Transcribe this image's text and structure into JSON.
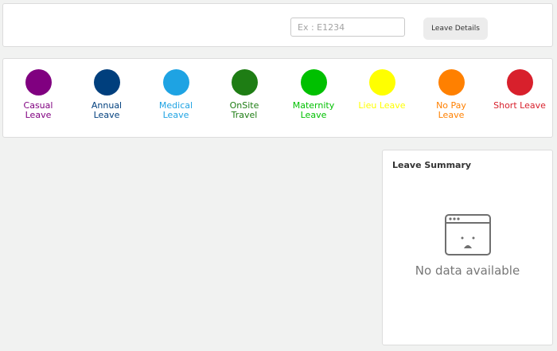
{
  "search": {
    "placeholder": "Ex : E1234",
    "value": ""
  },
  "toolbar": {
    "leave_details_label": "Leave Details"
  },
  "legend": [
    {
      "name": "casual",
      "line1": "Casual",
      "line2": "Leave",
      "color": "#800080"
    },
    {
      "name": "annual",
      "line1": "Annual",
      "line2": "Leave",
      "color": "#003f7d"
    },
    {
      "name": "medical",
      "line1": "Medical",
      "line2": "Leave",
      "color": "#1ea3e3"
    },
    {
      "name": "onsite-travel",
      "line1": "OnSite",
      "line2": "Travel",
      "color": "#1e7d14"
    },
    {
      "name": "maternity",
      "line1": "Maternity",
      "line2": "Leave",
      "color": "#00c000"
    },
    {
      "name": "lieu",
      "line1": "Lieu Leave",
      "line2": "",
      "color": "#ffff00"
    },
    {
      "name": "no-pay",
      "line1": "No Pay",
      "line2": "Leave",
      "color": "#ff8000"
    },
    {
      "name": "short",
      "line1": "Short Leave",
      "line2": "",
      "color": "#d8202c"
    }
  ],
  "summary": {
    "title": "Leave Summary",
    "empty_text": "No data available",
    "empty_icon": "sad-window-icon"
  }
}
